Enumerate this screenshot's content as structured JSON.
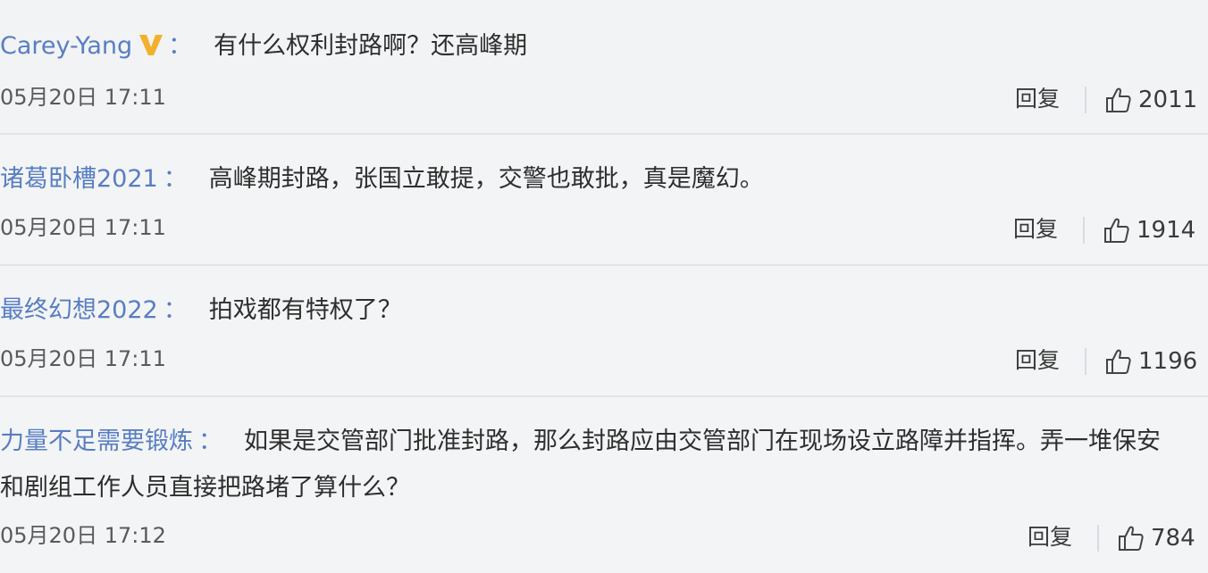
{
  "colors": {
    "username": "#587ec2",
    "text": "#2e2e2e",
    "meta": "#5a5a5a",
    "vip_badge": "#f2b12c"
  },
  "comments": [
    {
      "username": "Carey-Yang",
      "verified_icon": "vip-v-badge-icon",
      "colon": "：",
      "text": "有什么权利封路啊？还高峰期",
      "time": "05月20日 17:11",
      "reply_label": "回复",
      "likes": "2011",
      "like_icon": "thumbs-up-icon"
    },
    {
      "username": "诸葛卧槽2021",
      "colon": "：",
      "text": "高峰期封路，张国立敢提，交警也敢批，真是魔幻。",
      "time": "05月20日 17:11",
      "reply_label": "回复",
      "likes": "1914",
      "like_icon": "thumbs-up-icon"
    },
    {
      "username": "最终幻想2022",
      "colon": "：",
      "text": "拍戏都有特权了？",
      "time": "05月20日 17:11",
      "reply_label": "回复",
      "likes": "1196",
      "like_icon": "thumbs-up-icon"
    },
    {
      "username": "力量不足需要锻炼",
      "colon": "：",
      "text_line1": "如果是交管部门批准封路，那么封路应由交管部门在现场设立路障并指挥。弄一堆保安",
      "text_line2": "和剧组工作人员直接把路堵了算什么？",
      "time": "05月20日 17:12",
      "reply_label": "回复",
      "likes": "784",
      "like_icon": "thumbs-up-icon"
    }
  ]
}
